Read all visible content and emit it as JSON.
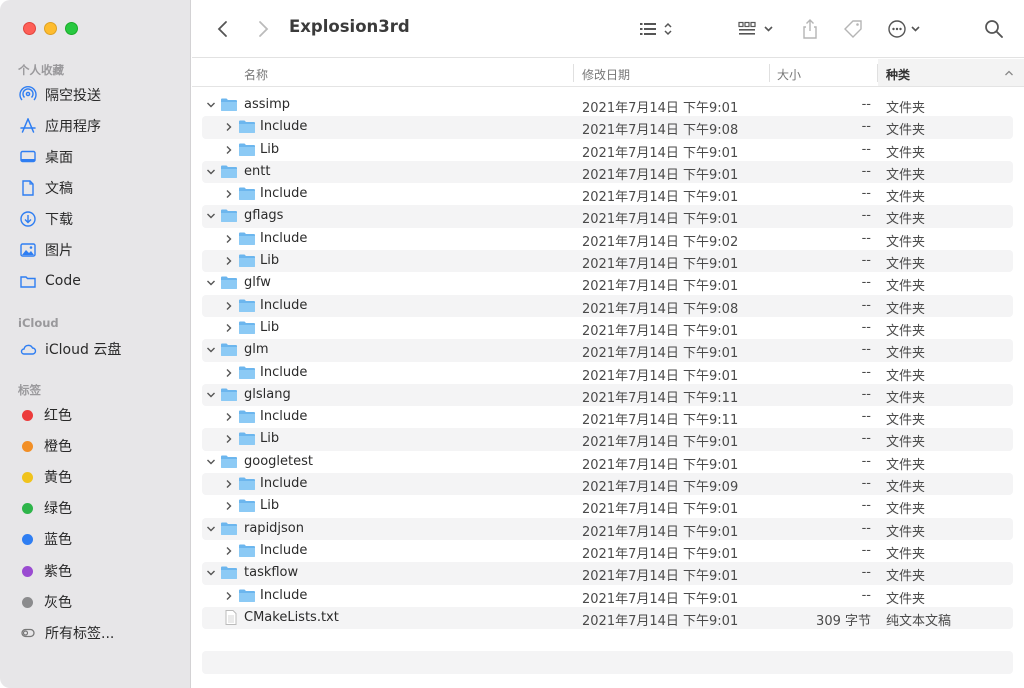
{
  "window": {
    "title": "Explosion3rd"
  },
  "sidebar": {
    "favorites_title": "个人收藏",
    "favorites": [
      {
        "label": "隔空投送",
        "icon": "airdrop-icon"
      },
      {
        "label": "应用程序",
        "icon": "applications-icon"
      },
      {
        "label": "桌面",
        "icon": "desktop-icon"
      },
      {
        "label": "文稿",
        "icon": "documents-icon"
      },
      {
        "label": "下载",
        "icon": "downloads-icon"
      },
      {
        "label": "图片",
        "icon": "pictures-icon"
      },
      {
        "label": "Code",
        "icon": "folder-icon"
      }
    ],
    "icloud_title": "iCloud",
    "icloud": [
      {
        "label": "iCloud 云盘",
        "icon": "icloud-icon"
      }
    ],
    "tags_title": "标签",
    "tags": [
      {
        "label": "红色",
        "color": "#ec3b3b"
      },
      {
        "label": "橙色",
        "color": "#f28f26"
      },
      {
        "label": "黄色",
        "color": "#f0c31c"
      },
      {
        "label": "绿色",
        "color": "#2eb54a"
      },
      {
        "label": "蓝色",
        "color": "#2f7ef2"
      },
      {
        "label": "紫色",
        "color": "#9a4bd1"
      },
      {
        "label": "灰色",
        "color": "#8b8b8d"
      },
      {
        "label": "所有标签...",
        "icon": "all-tags-icon"
      }
    ]
  },
  "columns": {
    "name": "名称",
    "date": "修改日期",
    "size": "大小",
    "kind": "种类"
  },
  "rows": [
    {
      "level": 0,
      "expanded": true,
      "name": "assimp",
      "date": "2021年7月14日 下午9:01",
      "size": "--",
      "kind": "文件夹",
      "type": "folder"
    },
    {
      "level": 1,
      "expanded": false,
      "name": "Include",
      "date": "2021年7月14日 下午9:08",
      "size": "--",
      "kind": "文件夹",
      "type": "folder"
    },
    {
      "level": 1,
      "expanded": false,
      "name": "Lib",
      "date": "2021年7月14日 下午9:01",
      "size": "--",
      "kind": "文件夹",
      "type": "folder"
    },
    {
      "level": 0,
      "expanded": true,
      "name": "entt",
      "date": "2021年7月14日 下午9:01",
      "size": "--",
      "kind": "文件夹",
      "type": "folder"
    },
    {
      "level": 1,
      "expanded": false,
      "name": "Include",
      "date": "2021年7月14日 下午9:01",
      "size": "--",
      "kind": "文件夹",
      "type": "folder"
    },
    {
      "level": 0,
      "expanded": true,
      "name": "gflags",
      "date": "2021年7月14日 下午9:01",
      "size": "--",
      "kind": "文件夹",
      "type": "folder"
    },
    {
      "level": 1,
      "expanded": false,
      "name": "Include",
      "date": "2021年7月14日 下午9:02",
      "size": "--",
      "kind": "文件夹",
      "type": "folder"
    },
    {
      "level": 1,
      "expanded": false,
      "name": "Lib",
      "date": "2021年7月14日 下午9:01",
      "size": "--",
      "kind": "文件夹",
      "type": "folder"
    },
    {
      "level": 0,
      "expanded": true,
      "name": "glfw",
      "date": "2021年7月14日 下午9:01",
      "size": "--",
      "kind": "文件夹",
      "type": "folder"
    },
    {
      "level": 1,
      "expanded": false,
      "name": "Include",
      "date": "2021年7月14日 下午9:08",
      "size": "--",
      "kind": "文件夹",
      "type": "folder"
    },
    {
      "level": 1,
      "expanded": false,
      "name": "Lib",
      "date": "2021年7月14日 下午9:01",
      "size": "--",
      "kind": "文件夹",
      "type": "folder"
    },
    {
      "level": 0,
      "expanded": true,
      "name": "glm",
      "date": "2021年7月14日 下午9:01",
      "size": "--",
      "kind": "文件夹",
      "type": "folder"
    },
    {
      "level": 1,
      "expanded": false,
      "name": "Include",
      "date": "2021年7月14日 下午9:01",
      "size": "--",
      "kind": "文件夹",
      "type": "folder"
    },
    {
      "level": 0,
      "expanded": true,
      "name": "glslang",
      "date": "2021年7月14日 下午9:11",
      "size": "--",
      "kind": "文件夹",
      "type": "folder"
    },
    {
      "level": 1,
      "expanded": false,
      "name": "Include",
      "date": "2021年7月14日 下午9:11",
      "size": "--",
      "kind": "文件夹",
      "type": "folder"
    },
    {
      "level": 1,
      "expanded": false,
      "name": "Lib",
      "date": "2021年7月14日 下午9:01",
      "size": "--",
      "kind": "文件夹",
      "type": "folder"
    },
    {
      "level": 0,
      "expanded": true,
      "name": "googletest",
      "date": "2021年7月14日 下午9:01",
      "size": "--",
      "kind": "文件夹",
      "type": "folder"
    },
    {
      "level": 1,
      "expanded": false,
      "name": "Include",
      "date": "2021年7月14日 下午9:09",
      "size": "--",
      "kind": "文件夹",
      "type": "folder"
    },
    {
      "level": 1,
      "expanded": false,
      "name": "Lib",
      "date": "2021年7月14日 下午9:01",
      "size": "--",
      "kind": "文件夹",
      "type": "folder"
    },
    {
      "level": 0,
      "expanded": true,
      "name": "rapidjson",
      "date": "2021年7月14日 下午9:01",
      "size": "--",
      "kind": "文件夹",
      "type": "folder"
    },
    {
      "level": 1,
      "expanded": false,
      "name": "Include",
      "date": "2021年7月14日 下午9:01",
      "size": "--",
      "kind": "文件夹",
      "type": "folder"
    },
    {
      "level": 0,
      "expanded": true,
      "name": "taskflow",
      "date": "2021年7月14日 下午9:01",
      "size": "--",
      "kind": "文件夹",
      "type": "folder"
    },
    {
      "level": 1,
      "expanded": false,
      "name": "Include",
      "date": "2021年7月14日 下午9:01",
      "size": "--",
      "kind": "文件夹",
      "type": "folder"
    },
    {
      "level": 0,
      "expanded": false,
      "name": "CMakeLists.txt",
      "date": "2021年7月14日 下午9:01",
      "size": "309 字节",
      "kind": "纯文本文稿",
      "type": "file"
    }
  ],
  "colors": {
    "accent": "#2f7ef2",
    "folder": "#6cb6ee",
    "sidebar_bg": "#e7e6e8"
  }
}
